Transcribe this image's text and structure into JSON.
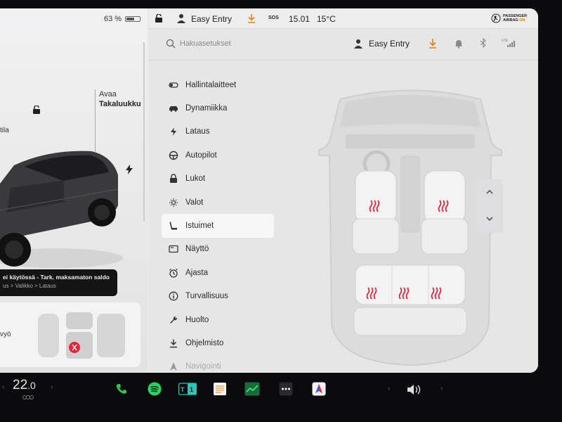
{
  "status": {
    "battery_percent": "63 %",
    "battery_level": 0.63,
    "profile": "Easy Entry",
    "sos": "SOS",
    "time": "15.01",
    "outside_temp": "15°C",
    "airbag": {
      "line1": "PASSENGER",
      "line2": "AIRBAG",
      "state": "ON"
    }
  },
  "left_panel": {
    "trunk_action": "Avaa",
    "trunk_label": "Takaluukku",
    "frunk_label": "tila",
    "toast": {
      "title": "ei käytössä - Tark. maksamaton saldo",
      "path": "us > Valikko > Lataus"
    },
    "seat_card_label": "vyö"
  },
  "settings": {
    "search_placeholder": "Hakuasetukset",
    "profile_label": "Easy Entry",
    "lte_label": "LTE",
    "menu": [
      {
        "label": "Hallintalaitteet",
        "icon": "toggle-icon"
      },
      {
        "label": "Dynamiikka",
        "icon": "car-icon"
      },
      {
        "label": "Lataus",
        "icon": "bolt-icon"
      },
      {
        "label": "Autopilot",
        "icon": "steering-wheel-icon"
      },
      {
        "label": "Lukot",
        "icon": "lock-icon"
      },
      {
        "label": "Valot",
        "icon": "light-icon"
      },
      {
        "label": "Istuimet",
        "icon": "seat-icon"
      },
      {
        "label": "Näyttö",
        "icon": "display-icon"
      },
      {
        "label": "Ajasta",
        "icon": "alarm-clock-icon"
      },
      {
        "label": "Turvallisuus",
        "icon": "info-icon"
      },
      {
        "label": "Huolto",
        "icon": "wrench-icon"
      },
      {
        "label": "Ohjelmisto",
        "icon": "download-icon"
      },
      {
        "label": "Navigointi",
        "icon": "navigation-icon"
      }
    ],
    "active_item": "Istuimet"
  },
  "seat_heaters": {
    "front_left": "on",
    "front_right": "on",
    "rear_left": "on",
    "rear_center": "on",
    "rear_right": "on"
  },
  "dock": {
    "cabin_temp": "22",
    "cabin_temp_decimal": ".0",
    "apps": [
      "phone-icon",
      "spotify-icon",
      "calendar-icon",
      "notes-icon",
      "stocks-icon",
      "more-icon",
      "navigation-app-icon"
    ]
  },
  "colors": {
    "accent": "#e8820c",
    "heat": "#e8243c",
    "phone": "#2ec44d",
    "spotify": "#1ed760"
  }
}
